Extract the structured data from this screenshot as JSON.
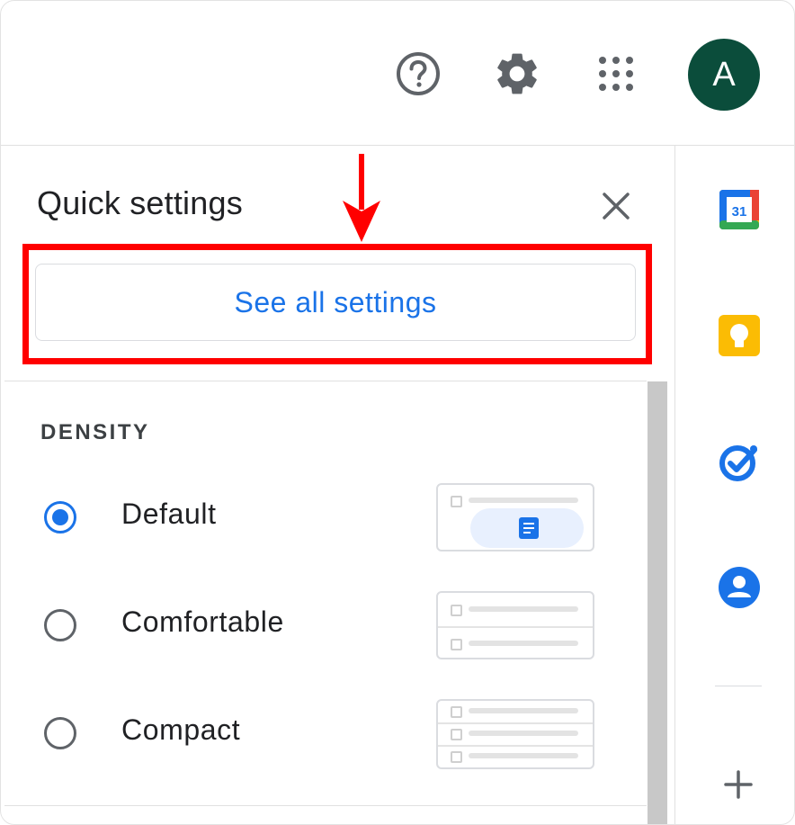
{
  "header": {
    "help_icon": "help-circle-icon",
    "settings_icon": "gear-icon",
    "apps_icon": "apps-grid-icon",
    "avatar_initial": "A",
    "avatar_color": "#0b4d3b"
  },
  "quick_settings": {
    "title": "Quick settings",
    "close_icon": "close-icon",
    "see_all_label": "See all settings",
    "highlight_color": "#ff0000",
    "accent_color": "#1a73e8"
  },
  "density": {
    "label": "DENSITY",
    "options": [
      {
        "label": "Default",
        "selected": true
      },
      {
        "label": "Comfortable",
        "selected": false
      },
      {
        "label": "Compact",
        "selected": false
      }
    ]
  },
  "side_rail": {
    "apps": [
      "calendar-icon",
      "keep-icon",
      "tasks-icon",
      "contacts-icon"
    ],
    "calendar_day": "31",
    "add_icon": "plus-icon"
  }
}
